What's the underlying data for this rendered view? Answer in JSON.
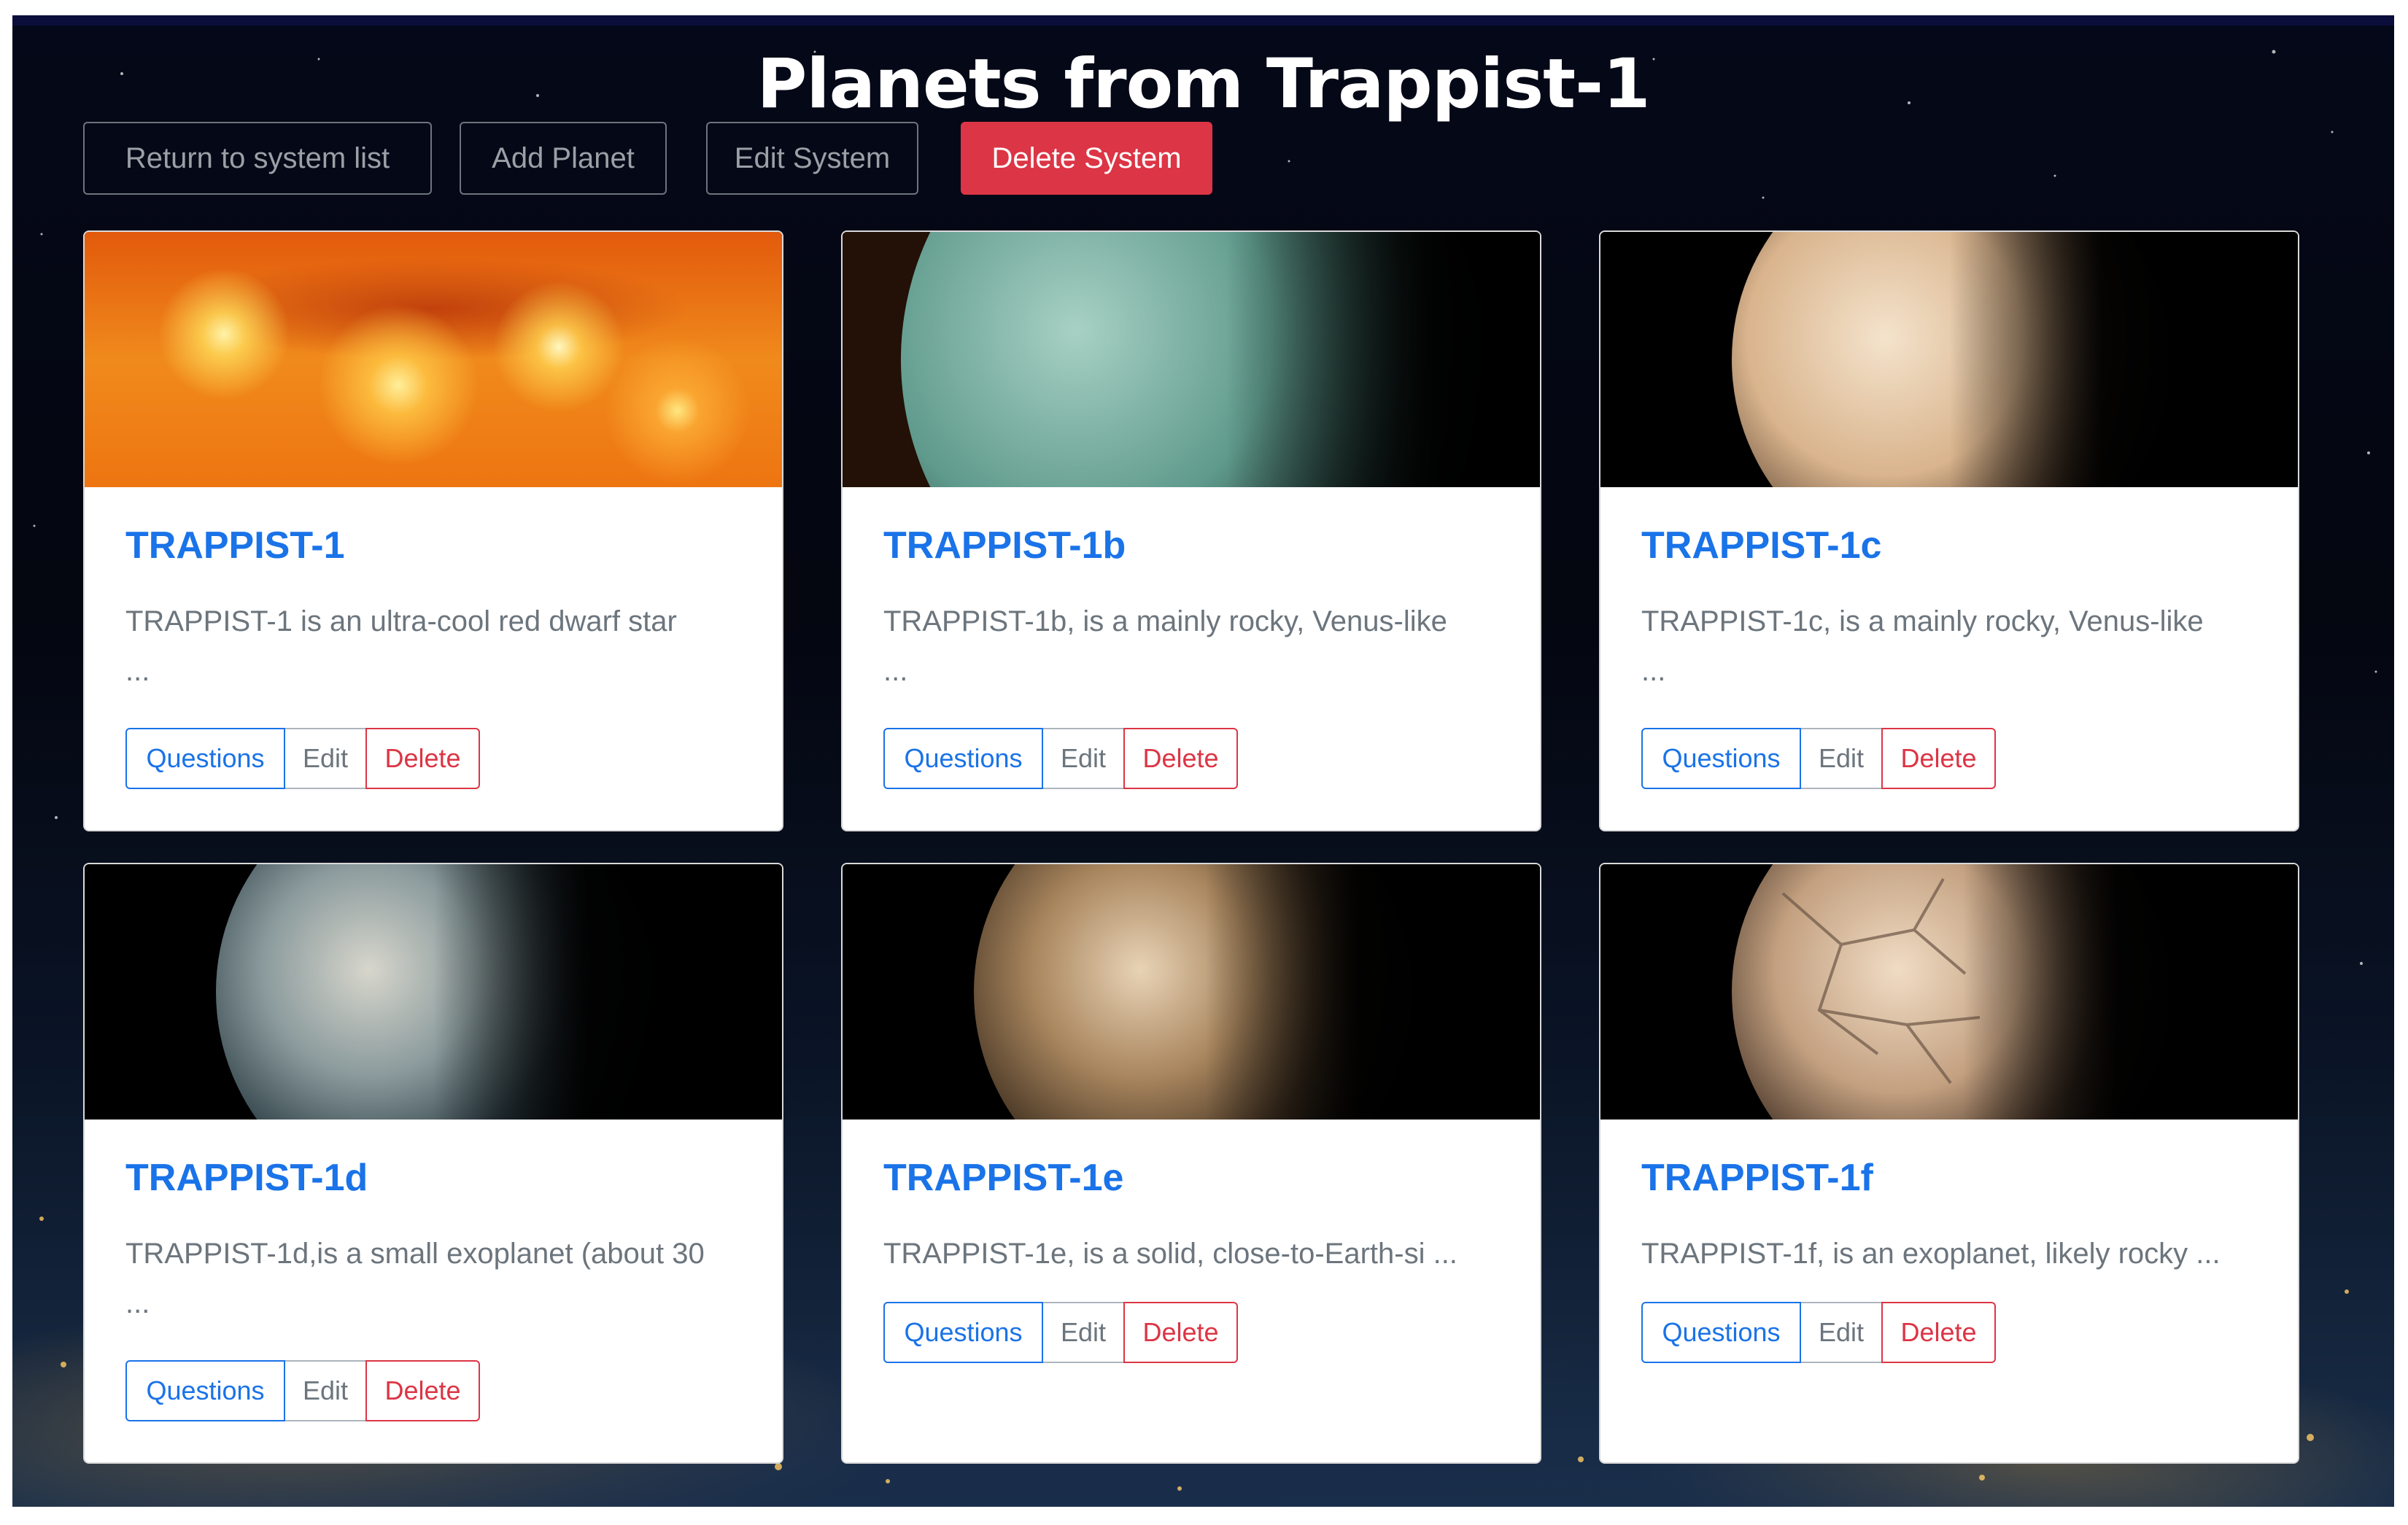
{
  "page": {
    "title": "Planets from Trappist-1"
  },
  "toolbar": {
    "return_label": "Return to system list",
    "add_label": "Add Planet",
    "edit_label": "Edit System",
    "delete_label": "Delete System"
  },
  "colors": {
    "primary": "#1a73e8",
    "danger": "#dc3545",
    "secondary": "#6c757d",
    "background": "#050818"
  },
  "card_buttons": {
    "questions": "Questions",
    "edit": "Edit",
    "delete": "Delete"
  },
  "cards": [
    {
      "name": "TRAPPIST-1",
      "description": "TRAPPIST-1 is an ultra-cool red dwarf star",
      "ellipsis": "...",
      "image": "star-surface-image"
    },
    {
      "name": "TRAPPIST-1b",
      "description": "TRAPPIST-1b, is a mainly rocky, Venus-like",
      "ellipsis": "...",
      "image": "planet-teal-image"
    },
    {
      "name": "TRAPPIST-1c",
      "description": "TRAPPIST-1c, is a mainly rocky, Venus-like",
      "ellipsis": "...",
      "image": "planet-cream-image"
    },
    {
      "name": "TRAPPIST-1d",
      "description": "TRAPPIST-1d,is a small exoplanet (about 30",
      "ellipsis": "...",
      "image": "planet-cloudy-image"
    },
    {
      "name": "TRAPPIST-1e",
      "description": "TRAPPIST-1e, is a solid, close-to-Earth-si ...",
      "ellipsis": "",
      "image": "planet-earthlike-image"
    },
    {
      "name": "TRAPPIST-1f",
      "description": "TRAPPIST-1f, is an exoplanet, likely rocky ...",
      "ellipsis": "",
      "image": "planet-cracked-image"
    }
  ]
}
